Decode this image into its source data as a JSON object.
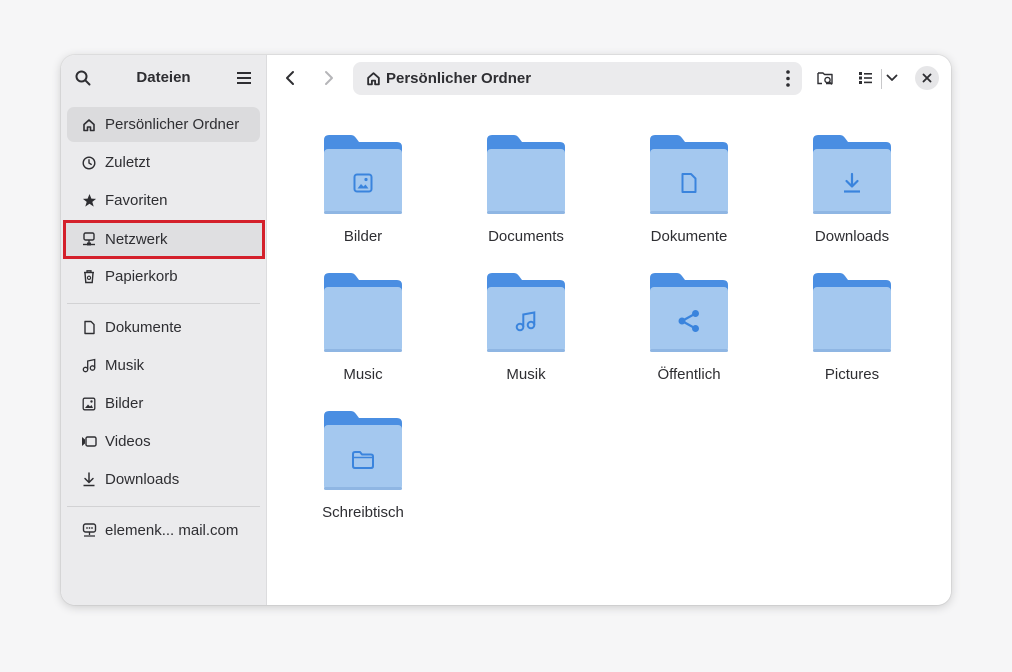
{
  "sidebar": {
    "title": "Dateien",
    "places": [
      {
        "label": "Persönlicher Ordner",
        "icon": "home-icon"
      },
      {
        "label": "Zuletzt",
        "icon": "clock-icon"
      },
      {
        "label": "Favoriten",
        "icon": "star-icon"
      },
      {
        "label": "Netzwerk",
        "icon": "network-icon"
      },
      {
        "label": "Papierkorb",
        "icon": "trash-icon"
      }
    ],
    "bookmarks": [
      {
        "label": "Dokumente",
        "icon": "document-icon"
      },
      {
        "label": "Musik",
        "icon": "music-icon"
      },
      {
        "label": "Bilder",
        "icon": "image-icon"
      },
      {
        "label": "Videos",
        "icon": "video-icon"
      },
      {
        "label": "Downloads",
        "icon": "download-icon"
      }
    ],
    "account": {
      "label": "elemenk... mail.com",
      "icon": "online-account-icon"
    }
  },
  "toolbar": {
    "path_label": "Persönlicher Ordner",
    "path_icon": "home-icon"
  },
  "files": [
    {
      "name": "Bilder",
      "emblem": "image-icon"
    },
    {
      "name": "Documents",
      "emblem": ""
    },
    {
      "name": "Dokumente",
      "emblem": "document-icon"
    },
    {
      "name": "Downloads",
      "emblem": "download-icon"
    },
    {
      "name": "Music",
      "emblem": ""
    },
    {
      "name": "Musik",
      "emblem": "music-icon"
    },
    {
      "name": "Öffentlich",
      "emblem": "share-icon"
    },
    {
      "name": "Pictures",
      "emblem": ""
    },
    {
      "name": "Schreibtisch",
      "emblem": "folder-icon"
    }
  ],
  "colors": {
    "folder_back": "#4a8ee2",
    "folder_front": "#a4c8ef",
    "emblem": "#3a84dd",
    "highlight": "#d4202b"
  }
}
